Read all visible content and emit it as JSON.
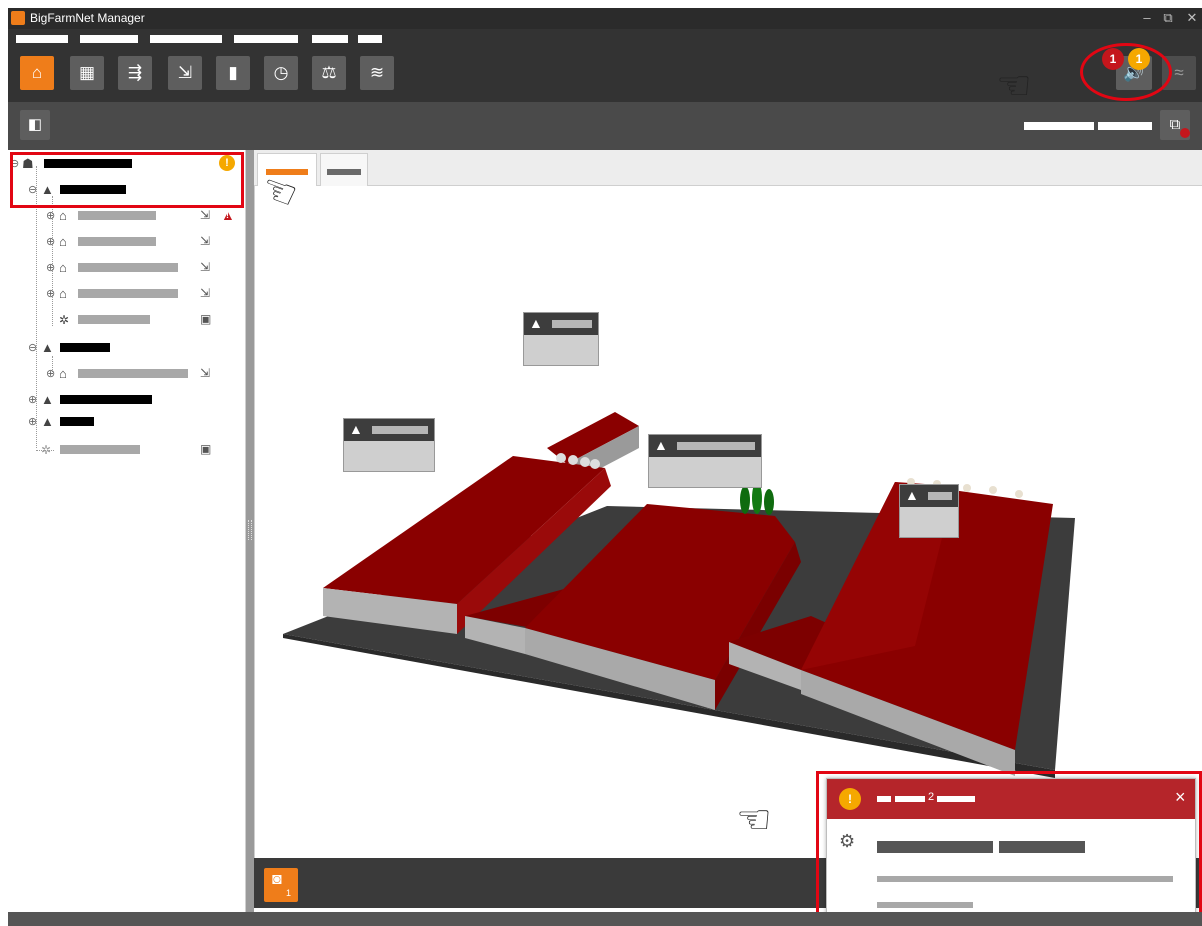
{
  "window": {
    "title": "BigFarmNet Manager",
    "minimize_glyph": "–",
    "restore_glyph": "⧉",
    "close_glyph": "✕"
  },
  "alarms": {
    "critical_count": "1",
    "warning_count": "1"
  },
  "toolbar": {
    "icons": [
      "farm-icon",
      "grid-icon",
      "animals-icon",
      "animal-move-icon",
      "silo-icon",
      "feed-time-icon",
      "scale-icon",
      "climate-icon"
    ],
    "sound_icon": "speaker-icon",
    "connection_icon": "wifi-icon"
  },
  "tree": {
    "warning_glyph": "!",
    "alarm_glyph": "!"
  },
  "camera": {
    "count": "1"
  },
  "notification": {
    "header_number": "2",
    "close_glyph": "×"
  },
  "colors": {
    "accent": "#ef7d1a",
    "critical": "#c4161c",
    "warning": "#f5a800",
    "roof": "#8b0000",
    "notify_header": "#b5252a"
  }
}
